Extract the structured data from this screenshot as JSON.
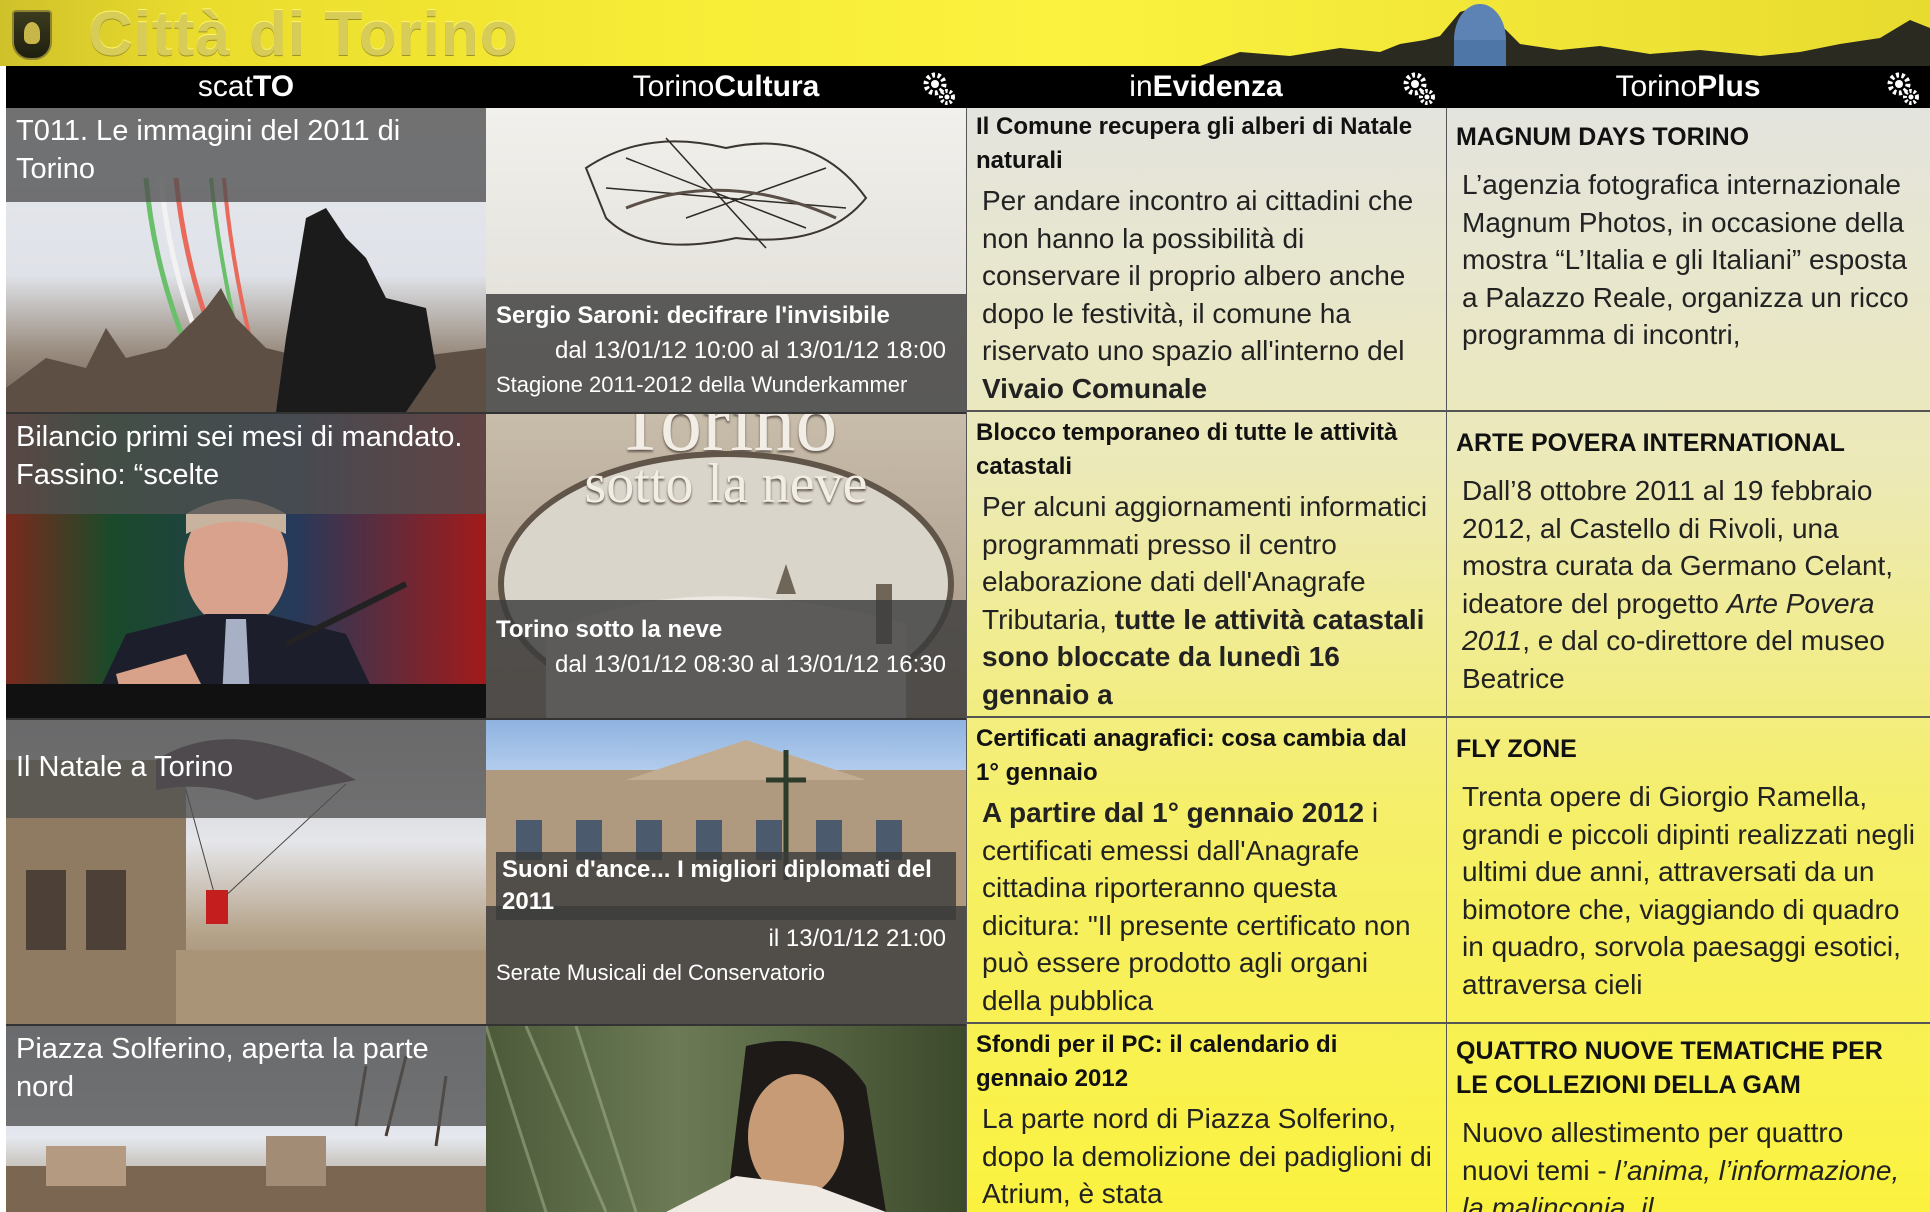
{
  "app": {
    "title": "Città di Torino"
  },
  "columns": {
    "scatto": {
      "name_pre": "scat",
      "name_bold": "TO",
      "tiles": [
        {
          "caption": "T011. Le immagini del 2011 di Torino"
        },
        {
          "caption": "Bilancio primi sei mesi di mandato. Fassino: “scelte"
        },
        {
          "caption": "Il Natale a Torino"
        },
        {
          "caption": "Piazza Solferino, aperta la parte nord"
        }
      ]
    },
    "cultura": {
      "name_pre": "Torino",
      "name_bold": "Cultura",
      "tiles": [
        {
          "title": "Sergio Saroni: decifrare l'invisibile",
          "when": "dal 13/01/12 10:00 al 13/01/12 18:00",
          "sub": "Stagione 2011-2012 della Wunderkammer"
        },
        {
          "title": "Torino sotto la neve",
          "when": "dal 13/01/12 08:30 al 13/01/12 16:30",
          "sub": "",
          "img_text_1": "Torino",
          "img_text_2": "sotto la neve"
        },
        {
          "title": "Suoni d'ance... I migliori diplomati del 2011",
          "when": "il 13/01/12 21:00",
          "sub": "Serate Musicali del Conservatorio"
        },
        {
          "title": "",
          "when": "",
          "sub": ""
        }
      ]
    },
    "evidenza": {
      "name_pre": "in",
      "name_bold": "Evidenza",
      "items": [
        {
          "title": "Il Comune recupera gli alberi di Natale naturali",
          "body": "Per andare incontro ai cittadini che non hanno la possibilità di conservare il proprio albero anche dopo le festività, il comune ha riservato uno spazio all'interno del ",
          "body_bold": "Vivaio Comunale"
        },
        {
          "title": "Blocco temporaneo di tutte le attività catastali",
          "body": "Per alcuni aggiornamenti informatici programmati presso il centro elaborazione dati dell'Anagrafe Tributaria, ",
          "body_bold": "tutte le attività catastali sono bloccate da lunedì 16 gennaio a"
        },
        {
          "title": "Certificati anagrafici: cosa cambia dal 1° gennaio",
          "body_bold_lead": "A partire dal 1° gennaio 2012",
          "body": " i certificati emessi dall'Anagrafe cittadina riporteranno questa dicitura: \"Il presente certificato non può essere prodotto agli organi della pubblica"
        },
        {
          "title": "Sfondi per il PC: il calendario di gennaio 2012",
          "body": "La parte nord di Piazza Solferino, dopo la demolizione dei padiglioni di Atrium, è stata"
        }
      ]
    },
    "plus": {
      "name_pre": "Torino",
      "name_bold": "Plus",
      "items": [
        {
          "title": "MAGNUM DAYS TORINO",
          "body": "L’agenzia fotografica internazionale Magnum Photos, in occasione della mostra “L’Italia e gli Italiani” esposta a Palazzo Reale, organizza un ricco programma di incontri,"
        },
        {
          "title": "ARTE POVERA INTERNATIONAL",
          "body_1": "Dall’8 ottobre 2011 al 19 febbraio 2012, al Castello di Rivoli, una mostra curata da Germano Celant, ideatore del progetto ",
          "body_italic": "Arte Povera 2011",
          "body_2": ", e dal co-direttore del museo Beatrice"
        },
        {
          "title": "FLY ZONE",
          "body": "Trenta opere di Giorgio Ramella, grandi e piccoli dipinti realizzati negli ultimi due anni, attraversati da un bimotore che, viaggiando di quadro in quadro, sorvola paesaggi esotici, attraversa cieli"
        },
        {
          "title": "QUATTRO NUOVE TEMATICHE PER LE COLLEZIONI DELLA GAM",
          "body_1": "Nuovo allestimento per quattro nuovi temi - ",
          "body_italic": "l’anima, l’informazione, la malinconia, il"
        }
      ]
    }
  },
  "icons": {
    "settings": "gear-icon",
    "logo": "city-crest-icon"
  },
  "colors": {
    "header_bar": "#000000",
    "banner_yellow": "#f7ed37",
    "text_tile_top": "#e3e3e3",
    "text_tile_bottom": "#fbf23f"
  }
}
